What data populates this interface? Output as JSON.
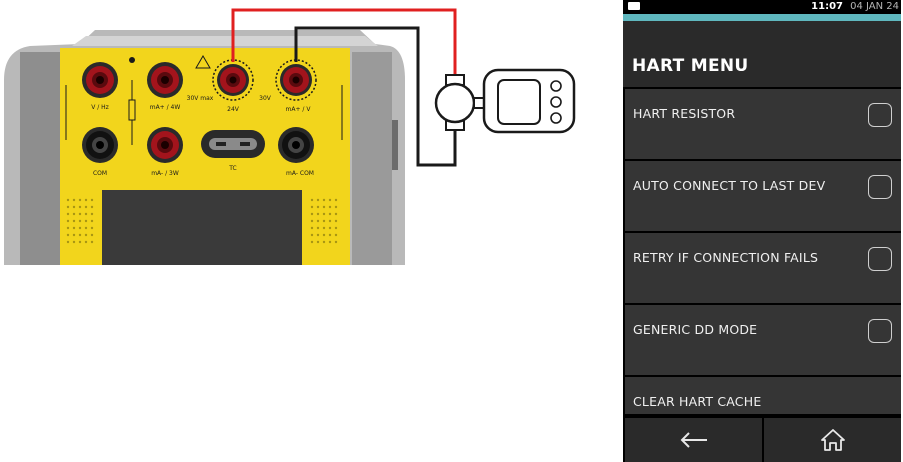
{
  "status_bar": {
    "time": "11:07",
    "date": "04 JAN 24",
    "battery_icon": "battery-icon"
  },
  "colors": {
    "accent": "#5fb7be",
    "wire_red": "#e02020",
    "wire_black": "#1a1a1a",
    "panel_yellow": "#f2d51c",
    "screen_bg": "#000000",
    "row_bg": "#353535"
  },
  "header": {
    "title": "HART MENU"
  },
  "menu_items": [
    {
      "label": "HART RESISTOR",
      "has_checkbox": true,
      "checked": false
    },
    {
      "label": "AUTO CONNECT TO LAST DEV",
      "has_checkbox": true,
      "checked": false
    },
    {
      "label": "RETRY IF CONNECTION FAILS",
      "has_checkbox": true,
      "checked": false
    },
    {
      "label": "GENERIC DD MODE",
      "has_checkbox": true,
      "checked": false
    },
    {
      "label": "CLEAR HART CACHE",
      "has_checkbox": false
    }
  ],
  "bottom_nav": {
    "back_icon": "back-arrow-icon",
    "home_icon": "home-icon"
  },
  "diagram": {
    "terminal_labels": {
      "v_hz": "V / Hz",
      "ma_4w": "mA+ / 4W",
      "v24": "24V",
      "ma_plus_v": "mA+ / V",
      "com1": "COM",
      "ma_3w": "mA- / 3W",
      "tc": "TC",
      "ma_minus_com": "mA- COM",
      "v30": "30V",
      "v_max": "30V max"
    }
  }
}
